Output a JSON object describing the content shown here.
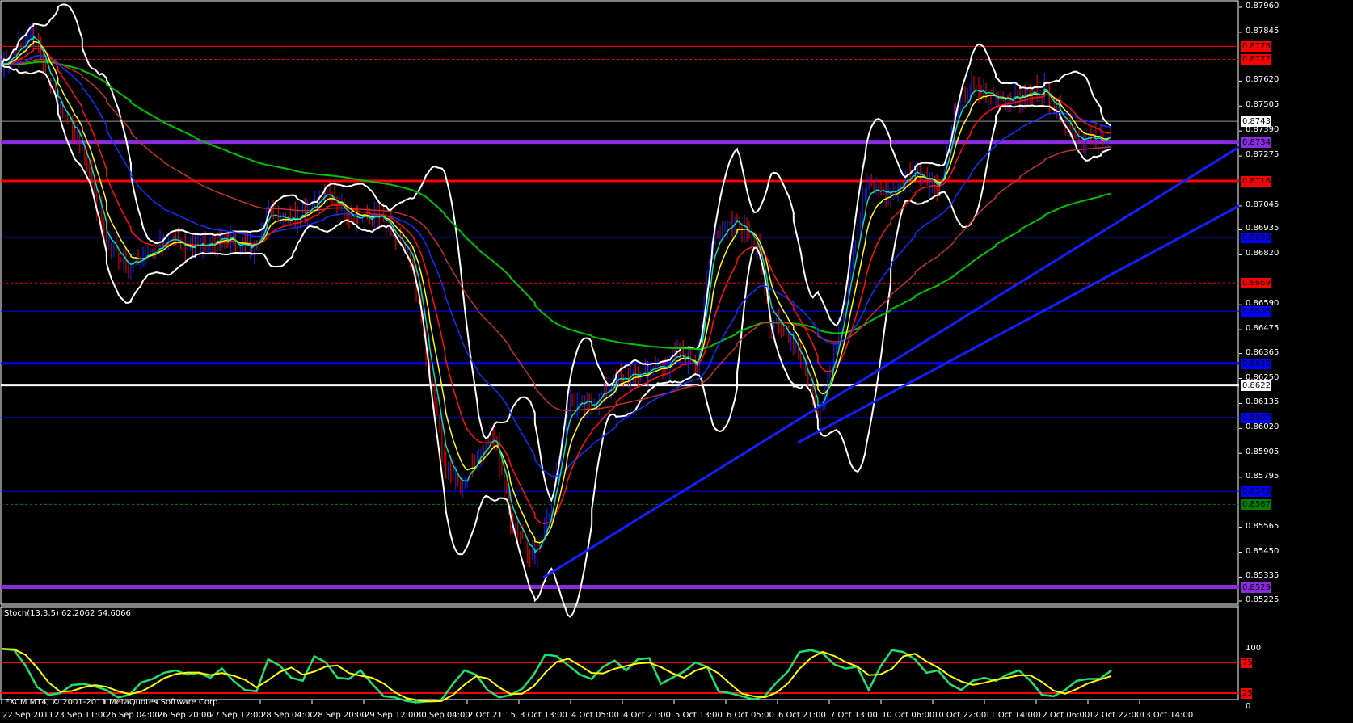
{
  "chart_data": {
    "type": "line",
    "title": "",
    "symbol_footer": "FXCM MT4, © 2001-2011 MetaQuotes Software Corp.",
    "ylim": [
      0.85225,
      0.8796
    ],
    "price_ticks": [
      "0.87960",
      "0.87845",
      "0.87620",
      "0.87505",
      "0.87390",
      "0.87275",
      "0.87045",
      "0.86935",
      "0.86820",
      "0.86590",
      "0.86475",
      "0.86365",
      "0.86250",
      "0.86135",
      "0.86020",
      "0.85905",
      "0.85795",
      "0.85565",
      "0.85450",
      "0.85335",
      "0.85225"
    ],
    "time_labels": [
      "22 Sep 2011",
      "23 Sep 11:00",
      "26 Sep 04:00",
      "26 Sep 20:00",
      "27 Sep 12:00",
      "28 Sep 04:00",
      "28 Sep 20:00",
      "29 Sep 12:00",
      "30 Sep 04:00",
      "2 Oct 21:15",
      "3 Oct 13:00",
      "4 Oct 05:00",
      "4 Oct 21:00",
      "5 Oct 13:00",
      "6 Oct 05:00",
      "6 Oct 21:00",
      "7 Oct 13:00",
      "10 Oct 06:00",
      "10 Oct 22:00",
      "11 Oct 14:00",
      "12 Oct 06:00",
      "12 Oct 22:00",
      "13 Oct 14:00"
    ],
    "price_path": {
      "x": [
        0,
        0.62,
        1.09,
        1.56,
        2.03,
        2.5,
        3.13,
        3.75,
        4.38,
        4.84,
        5.16,
        5.63,
        6.25,
        6.88,
        7.34,
        7.66,
        7.97,
        8.28,
        8.59,
        8.91,
        9.22,
        9.53,
        9.84,
        10.31,
        10.63,
        10.94,
        11.41,
        11.88,
        12.5,
        13.13,
        13.44,
        13.75,
        14.22,
        14.61,
        14.84,
        15.31,
        15.78,
        16.09,
        16.41,
        16.72,
        17.19,
        17.66,
        18.13,
        18.44,
        18.75,
        19.22,
        19.69,
        20.16,
        20.47,
        20.78,
        21.25,
        21.48
      ],
      "close": [
        0.87696,
        0.87845,
        0.8751,
        0.87324,
        0.86877,
        0.86766,
        0.86877,
        0.86859,
        0.86896,
        0.8684,
        0.87026,
        0.86989,
        0.871,
        0.86989,
        0.86989,
        0.86877,
        0.86766,
        0.86245,
        0.85835,
        0.85761,
        0.8591,
        0.85984,
        0.85612,
        0.85426,
        0.85686,
        0.86133,
        0.86133,
        0.86245,
        0.86282,
        0.86356,
        0.86319,
        0.86914,
        0.86989,
        0.86877,
        0.86505,
        0.86431,
        0.86096,
        0.86356,
        0.86803,
        0.87138,
        0.871,
        0.87212,
        0.87138,
        0.87473,
        0.87584,
        0.87547,
        0.87547,
        0.87584,
        0.87473,
        0.87361,
        0.87342,
        0.87398
      ]
    },
    "levels": [
      {
        "price": "0.87780",
        "color": "#ff0000",
        "style": "solid",
        "width": 1
      },
      {
        "price": "0.87720",
        "color": "#ff0000",
        "style": "dashed",
        "width": 1
      },
      {
        "price": "0.87435",
        "color": "#8a9aa8",
        "style": "solid",
        "width": 1,
        "label_color": "#ffffff"
      },
      {
        "price": "0.87340",
        "color": "#8a2be2",
        "style": "solid",
        "width": 5
      },
      {
        "price": "0.87160",
        "color": "#ff0000",
        "style": "solid",
        "width": 3
      },
      {
        "price": "0.86900",
        "color": "#0000ff",
        "style": "solid",
        "width": 1
      },
      {
        "price": "0.86690",
        "color": "#ff0000",
        "style": "dashed",
        "width": 1
      },
      {
        "price": "0.86560",
        "color": "#0000ff",
        "style": "solid",
        "width": 1
      },
      {
        "price": "0.86320",
        "color": "#0000ff",
        "style": "solid",
        "width": 3
      },
      {
        "price": "0.86220",
        "color": "#ffffff",
        "style": "solid",
        "width": 3
      },
      {
        "price": "0.86070",
        "color": "#0000ff",
        "style": "solid",
        "width": 1
      },
      {
        "price": "0.85730",
        "color": "#0000ff",
        "style": "solid",
        "width": 1
      },
      {
        "price": "0.85670",
        "color": "#008000",
        "style": "dashed",
        "width": 1
      },
      {
        "price": "0.85290",
        "color": "#8a2be2",
        "style": "solid",
        "width": 5
      }
    ],
    "trendlines": [
      {
        "x1": 10.47,
        "p1": 0.85333,
        "x2": 23.95,
        "p2": 0.87316
      },
      {
        "x1": 15.39,
        "p1": 0.85954,
        "x2": 23.95,
        "p2": 0.87045
      }
    ],
    "stoch": {
      "label": "Stoch(13,3,5) 62.2062 54.6066",
      "levels": [
        "75",
        "25"
      ],
      "scale": [
        "100",
        "0"
      ],
      "k": [
        97,
        95,
        70,
        35,
        22,
        25,
        38,
        40,
        36,
        30,
        18,
        22,
        42,
        48,
        58,
        62,
        55,
        58,
        50,
        65,
        45,
        30,
        28,
        80,
        70,
        50,
        45,
        85,
        75,
        50,
        48,
        62,
        40,
        20,
        18,
        12,
        10,
        12,
        14,
        40,
        62,
        55,
        30,
        18,
        22,
        32,
        55,
        88,
        85,
        70,
        55,
        48,
        68,
        78,
        62,
        80,
        82,
        40,
        50,
        60,
        75,
        68,
        28,
        25,
        20,
        15,
        20,
        42,
        60,
        92,
        95,
        90,
        72,
        65,
        68,
        30,
        68,
        95,
        92,
        80,
        58,
        62,
        40,
        30,
        45,
        50,
        45,
        55,
        62,
        45,
        22,
        20,
        30,
        45,
        48,
        48,
        62
      ]
    }
  }
}
